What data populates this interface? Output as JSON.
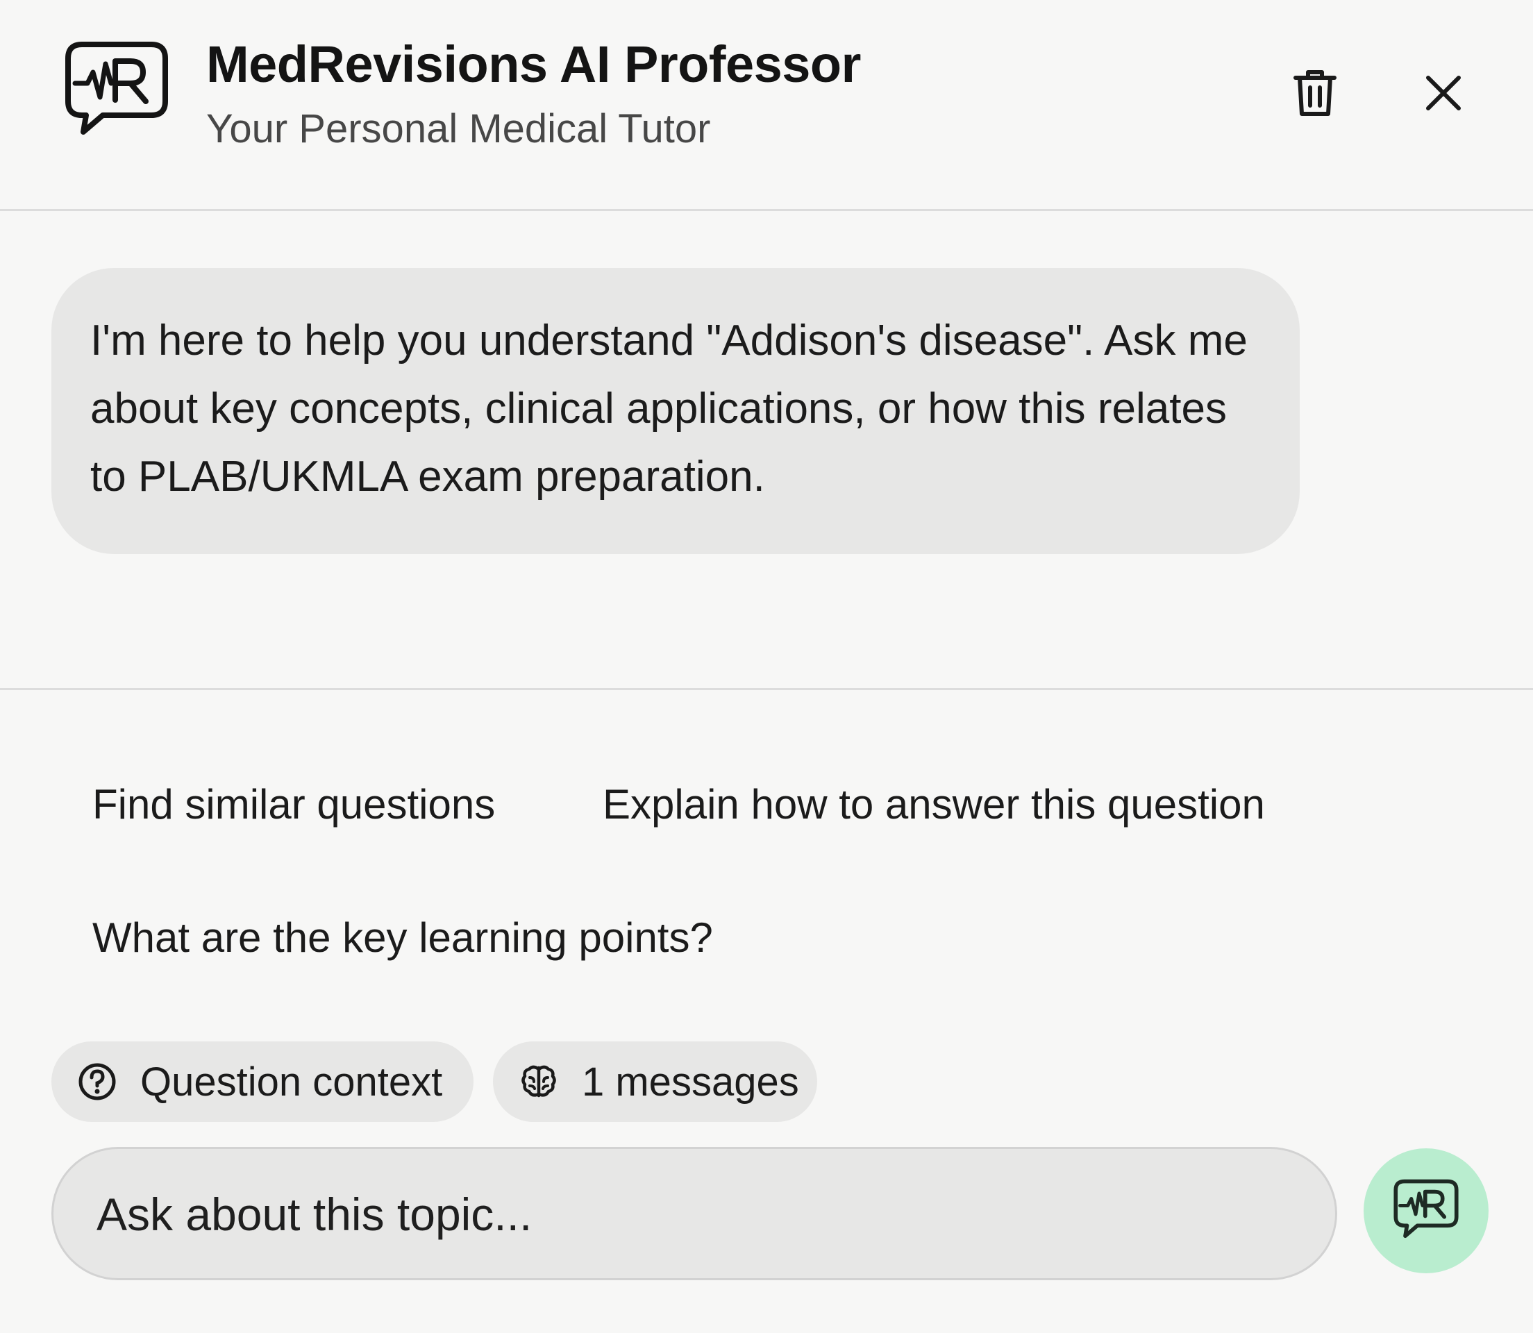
{
  "header": {
    "logo_icon": "medrevisions-heartbeat-logo-icon",
    "title": "MedRevisions AI Professor",
    "subtitle": "Your Personal Medical Tutor",
    "delete_icon": "trash-icon",
    "close_icon": "close-icon"
  },
  "chat": {
    "messages": [
      {
        "role": "assistant",
        "text": "I'm here to help you understand \"Addison's disease\". Ask me about key concepts, clinical applications, or how this relates to PLAB/UKMLA exam preparation."
      }
    ]
  },
  "suggestions": [
    "Find similar questions",
    "Explain how to answer this question",
    "What are the key learning points?"
  ],
  "chips": {
    "context": {
      "icon": "question-circle-icon",
      "label": "Question context"
    },
    "messages": {
      "icon": "brain-icon",
      "label": "1 messages"
    }
  },
  "composer": {
    "placeholder": "Ask about this topic...",
    "send_icon": "medrevisions-logo-send-icon",
    "send_color": "#b9edcf"
  }
}
